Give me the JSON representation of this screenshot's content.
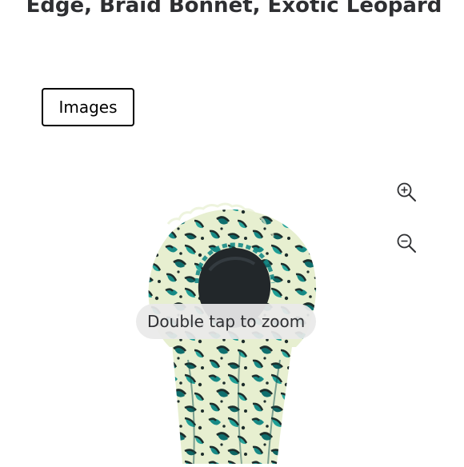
{
  "product": {
    "title": "Edge, Braid Bonnet, Exotic Leopard"
  },
  "tabs": {
    "images_label": "Images"
  },
  "viewer": {
    "zoom_in_icon": "zoom-in-icon",
    "zoom_out_icon": "zoom-out-icon",
    "hint": "Double tap to zoom",
    "image_description": "leopard-print-bonnet",
    "colors": {
      "base": "#e7efd0",
      "teal": "#178a86",
      "dark": "#1d2d2b",
      "lining": "#22272a"
    }
  }
}
